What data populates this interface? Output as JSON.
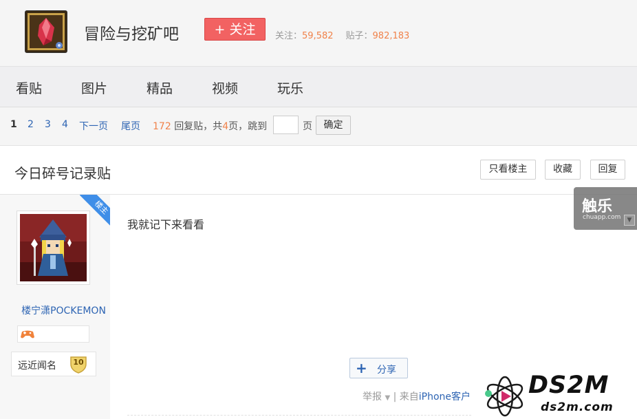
{
  "forum": {
    "name": "冒险与挖矿吧",
    "follow_label": "+ 关注",
    "followers_label": "关注：",
    "followers": "59,582",
    "posts_label": "贴子：",
    "posts": "982,183"
  },
  "nav": {
    "items": [
      {
        "label": "看贴"
      },
      {
        "label": "图片"
      },
      {
        "label": "精品"
      },
      {
        "label": "视频"
      },
      {
        "label": "玩乐"
      }
    ]
  },
  "pager": {
    "pages": [
      "1",
      "2",
      "3",
      "4"
    ],
    "current": "1",
    "next_label": "下一页",
    "last_label": "尾页",
    "reply_count": "172",
    "reply_text_a": "回复贴，共",
    "page_total": "4",
    "reply_text_b": "页，跳到",
    "page_unit": "页",
    "jump_value": "",
    "confirm_label": "确定"
  },
  "thread": {
    "title": "今日碎号记录贴",
    "only_op_label": "只看楼主",
    "favorite_label": "收藏",
    "reply_label": "回复"
  },
  "post": {
    "op_ribbon": "楼主",
    "author": "楼宁潇POCKEMON",
    "level_title": "远近闻名",
    "level": "10",
    "content": "我就记下来看看",
    "share_label": "分享",
    "report_label": "举报",
    "separator": "|",
    "source_prefix": "来自",
    "source_link": "iPhone客户"
  },
  "watermarks": {
    "chule_big": "触乐",
    "chule_small": "chuapp.com",
    "ds2m_big": "DS2M",
    "ds2m_small": "ds2m.com"
  },
  "colors": {
    "follow_button": "#f26262",
    "link": "#2d64b3",
    "number_accent": "#f0824a",
    "op_ribbon": "#3f8ee8"
  },
  "icons": {
    "forum_avatar": "red-gem-icon",
    "badge": "game-controller-icon",
    "level_badge": "shield-badge-icon",
    "share": "plus-icon",
    "report_dropdown": "caret-down-icon"
  }
}
